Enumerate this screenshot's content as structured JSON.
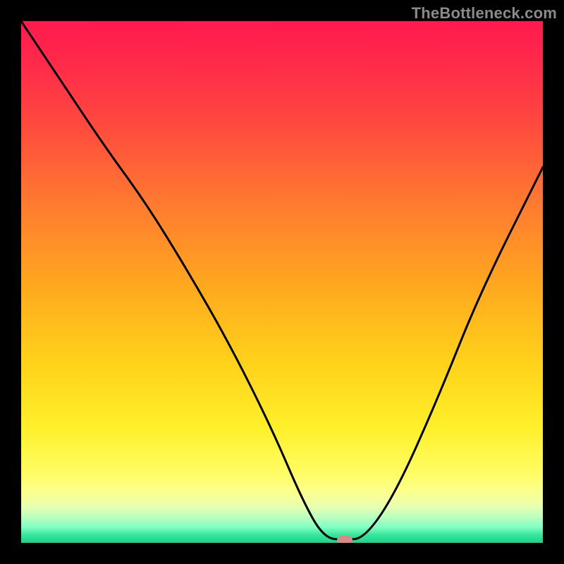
{
  "watermark": "TheBottleneck.com",
  "chart_data": {
    "type": "line",
    "title": "",
    "xlabel": "",
    "ylabel": "",
    "xlim": [
      0,
      100
    ],
    "ylim": [
      0,
      100
    ],
    "series": [
      {
        "name": "bottleneck-curve",
        "x": [
          0,
          8,
          16,
          24,
          32,
          40,
          48,
          54,
          58,
          62,
          66,
          72,
          80,
          88,
          100
        ],
        "y": [
          100,
          88,
          76,
          65,
          52,
          38,
          22,
          8,
          1,
          0.5,
          1,
          10,
          28,
          48,
          72
        ]
      }
    ],
    "marker": {
      "name": "optimal-point",
      "x": 62,
      "y": 0.5,
      "color": "#d98a87"
    },
    "background_gradient": {
      "direction": "vertical",
      "stops": [
        {
          "pos": 0.0,
          "color": "#ff1a4d"
        },
        {
          "pos": 0.5,
          "color": "#ffa61f"
        },
        {
          "pos": 0.86,
          "color": "#fffc60"
        },
        {
          "pos": 0.95,
          "color": "#baffc0"
        },
        {
          "pos": 1.0,
          "color": "#19d48a"
        }
      ]
    }
  }
}
